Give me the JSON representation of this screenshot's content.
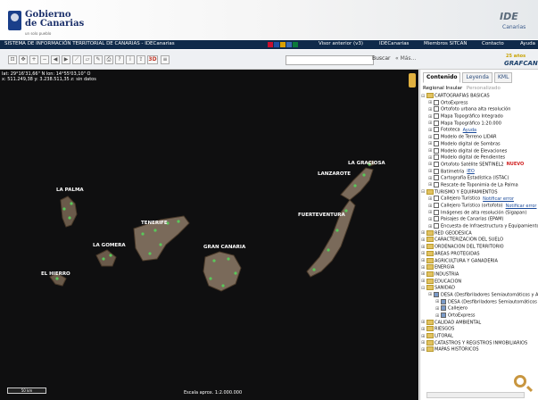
{
  "header": {
    "gov_title_line1": "Gobierno",
    "gov_title_line2": "de Canarias",
    "gov_subtitle": "un solo pueblo",
    "ide_logo": "IDE",
    "ide_sub": "Canarias"
  },
  "menubar": {
    "system_title": "SISTEMA DE INFORMACIÓN TERRITORIAL DE CANARIAS - IDECanarias",
    "items": [
      "Visor anterior (v3)",
      "IDECanarias",
      "Miembros SITCAN",
      "Contacto",
      "Ayuda"
    ],
    "flag_colors": [
      "#c8102e",
      "#d9a000",
      "#1f4ea1",
      "#c8102e",
      "#0a7a3a"
    ]
  },
  "toolbar": {
    "buttons": [
      "extent",
      "pan",
      "zoom-in",
      "zoom-out",
      "back",
      "forward",
      "measure",
      "area",
      "draw",
      "print",
      "query",
      "info",
      "export",
      "3D",
      "layers"
    ],
    "button_3d_label": "3D",
    "search_placeholder": "",
    "search_label": "Buscar",
    "more_label": "« Más..."
  },
  "branding": {
    "anniversary": "25 años",
    "grafcan": "GRAFCAN"
  },
  "map": {
    "coords_line1": "lat: 29°16'31,66\" N  lon: 14°55'03,10\" O",
    "coords_line2": "x: 511.249,38  y: 3.238.511,35  z: sin datos",
    "islands": [
      "LA PALMA",
      "LA GRACIOSA",
      "LANZAROTE",
      "TENERIFE",
      "FUERTEVENTURA",
      "LA GOMERA",
      "GRAN CANARIA",
      "EL HIERRO"
    ],
    "scale_bar_label": "50 km",
    "scale_text": "Escala aprox. 1:2.000.000"
  },
  "panel": {
    "tabs": [
      "Contenido",
      "Leyenda",
      "KML"
    ],
    "subtabs": [
      "Regional",
      "Insular",
      "Personalizado"
    ],
    "tree": [
      {
        "label": "CARTOGRAFÍAS BÁSICAS",
        "level": 0,
        "type": "folder",
        "expanded": true
      },
      {
        "label": "OrtoExpress",
        "level": 1,
        "checked": false
      },
      {
        "label": "Ortofoto urbana alta resolución",
        "level": 1,
        "checked": false
      },
      {
        "label": "Mapa Topográfico Integrado",
        "level": 1,
        "checked": false
      },
      {
        "label": "Mapa Topográfico 1:20.000",
        "level": 1,
        "checked": false
      },
      {
        "label": "Fototeca",
        "level": 1,
        "checked": false,
        "link": "Ayuda"
      },
      {
        "label": "Modelo de Terreno LIDAR",
        "level": 1,
        "checked": false
      },
      {
        "label": "Modelo digital de Sombras",
        "level": 1,
        "checked": false
      },
      {
        "label": "Modelo digital de Elevaciones",
        "level": 1,
        "checked": false
      },
      {
        "label": "Modelo digital de Pendientes",
        "level": 1,
        "checked": false
      },
      {
        "label": "Ortofoto Satélite SENTINEL2",
        "level": 1,
        "checked": false,
        "new": "NUEVO"
      },
      {
        "label": "Batimetría",
        "level": 1,
        "checked": false,
        "link": "IEO"
      },
      {
        "label": "Cartografía Estadística (ISTAC)",
        "level": 1,
        "checked": false
      },
      {
        "label": "Rescate de Toponimia de La Palma",
        "level": 1,
        "checked": false
      },
      {
        "label": "TURISMO Y EQUIPAMIENTOS",
        "level": 0,
        "type": "folder",
        "expanded": true
      },
      {
        "label": "Callejero Turístico",
        "level": 1,
        "checked": false,
        "link": "Notificar error"
      },
      {
        "label": "Callejero Turístico (ortofoto)",
        "level": 1,
        "checked": false,
        "link": "Notificar error"
      },
      {
        "label": "Imágenes de alta resolución (Sigapan)",
        "level": 1,
        "checked": false
      },
      {
        "label": "Paisajes de Canarias (EPAM)",
        "level": 1,
        "checked": false
      },
      {
        "label": "Encuesta de Infraestructura y Equipamientos",
        "level": 1,
        "checked": false
      },
      {
        "label": "RED GEODÉSICA",
        "level": 0,
        "type": "folder"
      },
      {
        "label": "CARACTERIZACIÓN DEL SUELO",
        "level": 0,
        "type": "folder"
      },
      {
        "label": "ORDENACIÓN DEL TERRITORIO",
        "level": 0,
        "type": "folder"
      },
      {
        "label": "ÁREAS PROTEGIDAS",
        "level": 0,
        "type": "folder"
      },
      {
        "label": "AGRICULTURA Y GANADERÍA",
        "level": 0,
        "type": "folder"
      },
      {
        "label": "ENERGÍA",
        "level": 0,
        "type": "folder"
      },
      {
        "label": "INDUSTRIA",
        "level": 0,
        "type": "folder"
      },
      {
        "label": "EDUCACIÓN",
        "level": 0,
        "type": "folder"
      },
      {
        "label": "SANIDAD",
        "level": 0,
        "type": "folder",
        "expanded": true
      },
      {
        "label": "DESA (Desfibriladores Semiautomáticos y Automáticos)",
        "level": 1,
        "checked": true
      },
      {
        "label": "DESA (Desfibriladores Semiautomáticos y Automáticos)",
        "level": 2,
        "checked": true
      },
      {
        "label": "Callejero",
        "level": 2,
        "checked": true
      },
      {
        "label": "OrtoExpress",
        "level": 2,
        "checked": true
      },
      {
        "label": "CALIDAD AMBIENTAL",
        "level": 0,
        "type": "folder"
      },
      {
        "label": "RIESGOS",
        "level": 0,
        "type": "folder"
      },
      {
        "label": "LITORAL",
        "level": 0,
        "type": "folder"
      },
      {
        "label": "CATASTROS Y REGISTROS INMOBILIARIOS",
        "level": 0,
        "type": "folder"
      },
      {
        "label": "MAPAS HISTÓRICOS",
        "level": 0,
        "type": "folder"
      }
    ]
  },
  "colors": {
    "menubar_bg": "#0f2a4a",
    "map_bg": "#0f0f10",
    "island_fill": "#6a5a4a",
    "poi_marker": "#5ac85a",
    "new_badge": "#d02020"
  }
}
